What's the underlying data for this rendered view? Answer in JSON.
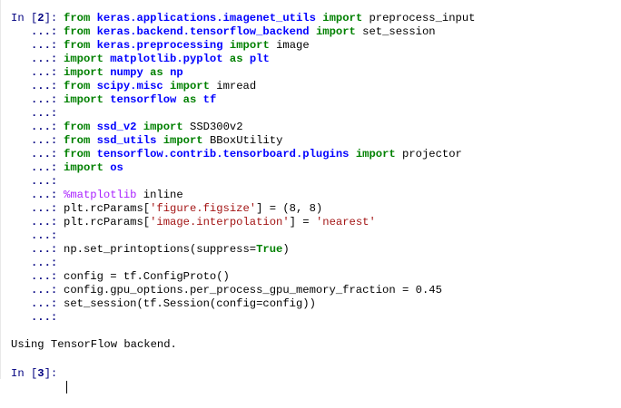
{
  "cell_in": {
    "prompt": "In [2]:",
    "continuation": "...:",
    "lines": [
      {
        "tokens": [
          {
            "t": "from ",
            "c": "kw"
          },
          {
            "t": "keras.applications.imagenet_utils",
            "c": "mod"
          },
          {
            "t": " ",
            "c": ""
          },
          {
            "t": "import",
            "c": "kw"
          },
          {
            "t": " preprocess_input",
            "c": ""
          }
        ]
      },
      {
        "tokens": [
          {
            "t": "from ",
            "c": "kw"
          },
          {
            "t": "keras.backend.tensorflow_backend",
            "c": "mod"
          },
          {
            "t": " ",
            "c": ""
          },
          {
            "t": "import",
            "c": "kw"
          },
          {
            "t": " set_session",
            "c": ""
          }
        ]
      },
      {
        "tokens": [
          {
            "t": "from ",
            "c": "kw"
          },
          {
            "t": "keras.preprocessing",
            "c": "mod"
          },
          {
            "t": " ",
            "c": ""
          },
          {
            "t": "import",
            "c": "kw"
          },
          {
            "t": " image",
            "c": ""
          }
        ]
      },
      {
        "tokens": [
          {
            "t": "import ",
            "c": "kw"
          },
          {
            "t": "matplotlib.pyplot",
            "c": "mod"
          },
          {
            "t": " ",
            "c": ""
          },
          {
            "t": "as",
            "c": "kw"
          },
          {
            "t": " ",
            "c": ""
          },
          {
            "t": "plt",
            "c": "mod"
          }
        ]
      },
      {
        "tokens": [
          {
            "t": "import ",
            "c": "kw"
          },
          {
            "t": "numpy",
            "c": "mod"
          },
          {
            "t": " ",
            "c": ""
          },
          {
            "t": "as",
            "c": "kw"
          },
          {
            "t": " ",
            "c": ""
          },
          {
            "t": "np",
            "c": "mod"
          }
        ]
      },
      {
        "tokens": [
          {
            "t": "from ",
            "c": "kw"
          },
          {
            "t": "scipy.misc",
            "c": "mod"
          },
          {
            "t": " ",
            "c": ""
          },
          {
            "t": "import",
            "c": "kw"
          },
          {
            "t": " imread",
            "c": ""
          }
        ]
      },
      {
        "tokens": [
          {
            "t": "import ",
            "c": "kw"
          },
          {
            "t": "tensorflow",
            "c": "mod"
          },
          {
            "t": " ",
            "c": ""
          },
          {
            "t": "as",
            "c": "kw"
          },
          {
            "t": " ",
            "c": ""
          },
          {
            "t": "tf",
            "c": "mod"
          }
        ]
      },
      {
        "tokens": []
      },
      {
        "tokens": [
          {
            "t": "from ",
            "c": "kw"
          },
          {
            "t": "ssd_v2",
            "c": "mod"
          },
          {
            "t": " ",
            "c": ""
          },
          {
            "t": "import",
            "c": "kw"
          },
          {
            "t": " SSD300v2",
            "c": ""
          }
        ]
      },
      {
        "tokens": [
          {
            "t": "from ",
            "c": "kw"
          },
          {
            "t": "ssd_utils",
            "c": "mod"
          },
          {
            "t": " ",
            "c": ""
          },
          {
            "t": "import",
            "c": "kw"
          },
          {
            "t": " BBoxUtility",
            "c": ""
          }
        ]
      },
      {
        "tokens": [
          {
            "t": "from ",
            "c": "kw"
          },
          {
            "t": "tensorflow.contrib.tensorboard.plugins",
            "c": "mod"
          },
          {
            "t": " ",
            "c": ""
          },
          {
            "t": "import",
            "c": "kw"
          },
          {
            "t": " projector",
            "c": ""
          }
        ]
      },
      {
        "tokens": [
          {
            "t": "import ",
            "c": "kw"
          },
          {
            "t": "os",
            "c": "mod"
          }
        ]
      },
      {
        "tokens": []
      },
      {
        "tokens": [
          {
            "t": "%matplotlib",
            "c": "magic"
          },
          {
            "t": " inline",
            "c": ""
          }
        ]
      },
      {
        "tokens": [
          {
            "t": "plt.rcParams[",
            "c": ""
          },
          {
            "t": "'figure.figsize'",
            "c": "str"
          },
          {
            "t": "] = (8, 8)",
            "c": ""
          }
        ]
      },
      {
        "tokens": [
          {
            "t": "plt.rcParams[",
            "c": ""
          },
          {
            "t": "'image.interpolation'",
            "c": "str"
          },
          {
            "t": "] = ",
            "c": ""
          },
          {
            "t": "'nearest'",
            "c": "str"
          }
        ]
      },
      {
        "tokens": []
      },
      {
        "tokens": [
          {
            "t": "np.set_printoptions(suppress=",
            "c": ""
          },
          {
            "t": "True",
            "c": "kw"
          },
          {
            "t": ")",
            "c": ""
          }
        ]
      },
      {
        "tokens": []
      },
      {
        "tokens": [
          {
            "t": "config = tf.ConfigProto()",
            "c": ""
          }
        ]
      },
      {
        "tokens": [
          {
            "t": "config.gpu_options.per_process_gpu_memory_fraction = 0.45",
            "c": ""
          }
        ]
      },
      {
        "tokens": [
          {
            "t": "set_session(tf.Session(config=config))",
            "c": ""
          }
        ]
      },
      {
        "tokens": []
      }
    ]
  },
  "output_text": "Using TensorFlow backend.",
  "cell_next": {
    "prompt": "In [3]:",
    "value": ""
  },
  "colors": {
    "keyword": "#008000",
    "module": "#0000ff",
    "string": "#a31515",
    "magic": "#aa22ff",
    "prompt": "#000080"
  }
}
